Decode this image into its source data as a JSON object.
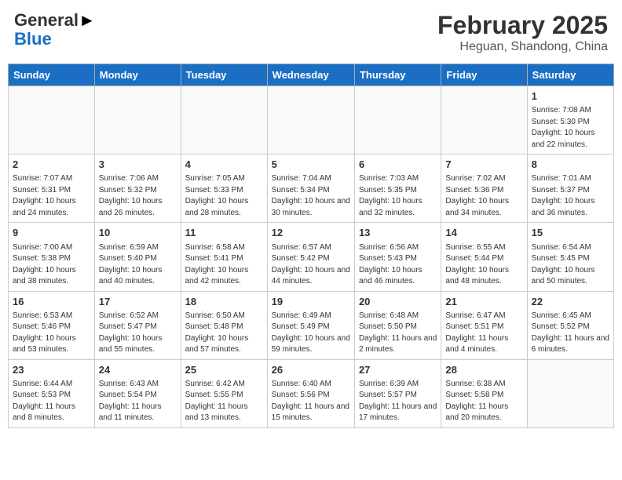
{
  "header": {
    "logo_line1": "General",
    "logo_line2": "Blue",
    "title": "February 2025",
    "subtitle": "Heguan, Shandong, China"
  },
  "days_of_week": [
    "Sunday",
    "Monday",
    "Tuesday",
    "Wednesday",
    "Thursday",
    "Friday",
    "Saturday"
  ],
  "weeks": [
    [
      {
        "day": "",
        "info": ""
      },
      {
        "day": "",
        "info": ""
      },
      {
        "day": "",
        "info": ""
      },
      {
        "day": "",
        "info": ""
      },
      {
        "day": "",
        "info": ""
      },
      {
        "day": "",
        "info": ""
      },
      {
        "day": "1",
        "info": "Sunrise: 7:08 AM\nSunset: 5:30 PM\nDaylight: 10 hours and 22 minutes."
      }
    ],
    [
      {
        "day": "2",
        "info": "Sunrise: 7:07 AM\nSunset: 5:31 PM\nDaylight: 10 hours and 24 minutes."
      },
      {
        "day": "3",
        "info": "Sunrise: 7:06 AM\nSunset: 5:32 PM\nDaylight: 10 hours and 26 minutes."
      },
      {
        "day": "4",
        "info": "Sunrise: 7:05 AM\nSunset: 5:33 PM\nDaylight: 10 hours and 28 minutes."
      },
      {
        "day": "5",
        "info": "Sunrise: 7:04 AM\nSunset: 5:34 PM\nDaylight: 10 hours and 30 minutes."
      },
      {
        "day": "6",
        "info": "Sunrise: 7:03 AM\nSunset: 5:35 PM\nDaylight: 10 hours and 32 minutes."
      },
      {
        "day": "7",
        "info": "Sunrise: 7:02 AM\nSunset: 5:36 PM\nDaylight: 10 hours and 34 minutes."
      },
      {
        "day": "8",
        "info": "Sunrise: 7:01 AM\nSunset: 5:37 PM\nDaylight: 10 hours and 36 minutes."
      }
    ],
    [
      {
        "day": "9",
        "info": "Sunrise: 7:00 AM\nSunset: 5:38 PM\nDaylight: 10 hours and 38 minutes."
      },
      {
        "day": "10",
        "info": "Sunrise: 6:59 AM\nSunset: 5:40 PM\nDaylight: 10 hours and 40 minutes."
      },
      {
        "day": "11",
        "info": "Sunrise: 6:58 AM\nSunset: 5:41 PM\nDaylight: 10 hours and 42 minutes."
      },
      {
        "day": "12",
        "info": "Sunrise: 6:57 AM\nSunset: 5:42 PM\nDaylight: 10 hours and 44 minutes."
      },
      {
        "day": "13",
        "info": "Sunrise: 6:56 AM\nSunset: 5:43 PM\nDaylight: 10 hours and 46 minutes."
      },
      {
        "day": "14",
        "info": "Sunrise: 6:55 AM\nSunset: 5:44 PM\nDaylight: 10 hours and 48 minutes."
      },
      {
        "day": "15",
        "info": "Sunrise: 6:54 AM\nSunset: 5:45 PM\nDaylight: 10 hours and 50 minutes."
      }
    ],
    [
      {
        "day": "16",
        "info": "Sunrise: 6:53 AM\nSunset: 5:46 PM\nDaylight: 10 hours and 53 minutes."
      },
      {
        "day": "17",
        "info": "Sunrise: 6:52 AM\nSunset: 5:47 PM\nDaylight: 10 hours and 55 minutes."
      },
      {
        "day": "18",
        "info": "Sunrise: 6:50 AM\nSunset: 5:48 PM\nDaylight: 10 hours and 57 minutes."
      },
      {
        "day": "19",
        "info": "Sunrise: 6:49 AM\nSunset: 5:49 PM\nDaylight: 10 hours and 59 minutes."
      },
      {
        "day": "20",
        "info": "Sunrise: 6:48 AM\nSunset: 5:50 PM\nDaylight: 11 hours and 2 minutes."
      },
      {
        "day": "21",
        "info": "Sunrise: 6:47 AM\nSunset: 5:51 PM\nDaylight: 11 hours and 4 minutes."
      },
      {
        "day": "22",
        "info": "Sunrise: 6:45 AM\nSunset: 5:52 PM\nDaylight: 11 hours and 6 minutes."
      }
    ],
    [
      {
        "day": "23",
        "info": "Sunrise: 6:44 AM\nSunset: 5:53 PM\nDaylight: 11 hours and 8 minutes."
      },
      {
        "day": "24",
        "info": "Sunrise: 6:43 AM\nSunset: 5:54 PM\nDaylight: 11 hours and 11 minutes."
      },
      {
        "day": "25",
        "info": "Sunrise: 6:42 AM\nSunset: 5:55 PM\nDaylight: 11 hours and 13 minutes."
      },
      {
        "day": "26",
        "info": "Sunrise: 6:40 AM\nSunset: 5:56 PM\nDaylight: 11 hours and 15 minutes."
      },
      {
        "day": "27",
        "info": "Sunrise: 6:39 AM\nSunset: 5:57 PM\nDaylight: 11 hours and 17 minutes."
      },
      {
        "day": "28",
        "info": "Sunrise: 6:38 AM\nSunset: 5:58 PM\nDaylight: 11 hours and 20 minutes."
      },
      {
        "day": "",
        "info": ""
      }
    ]
  ]
}
